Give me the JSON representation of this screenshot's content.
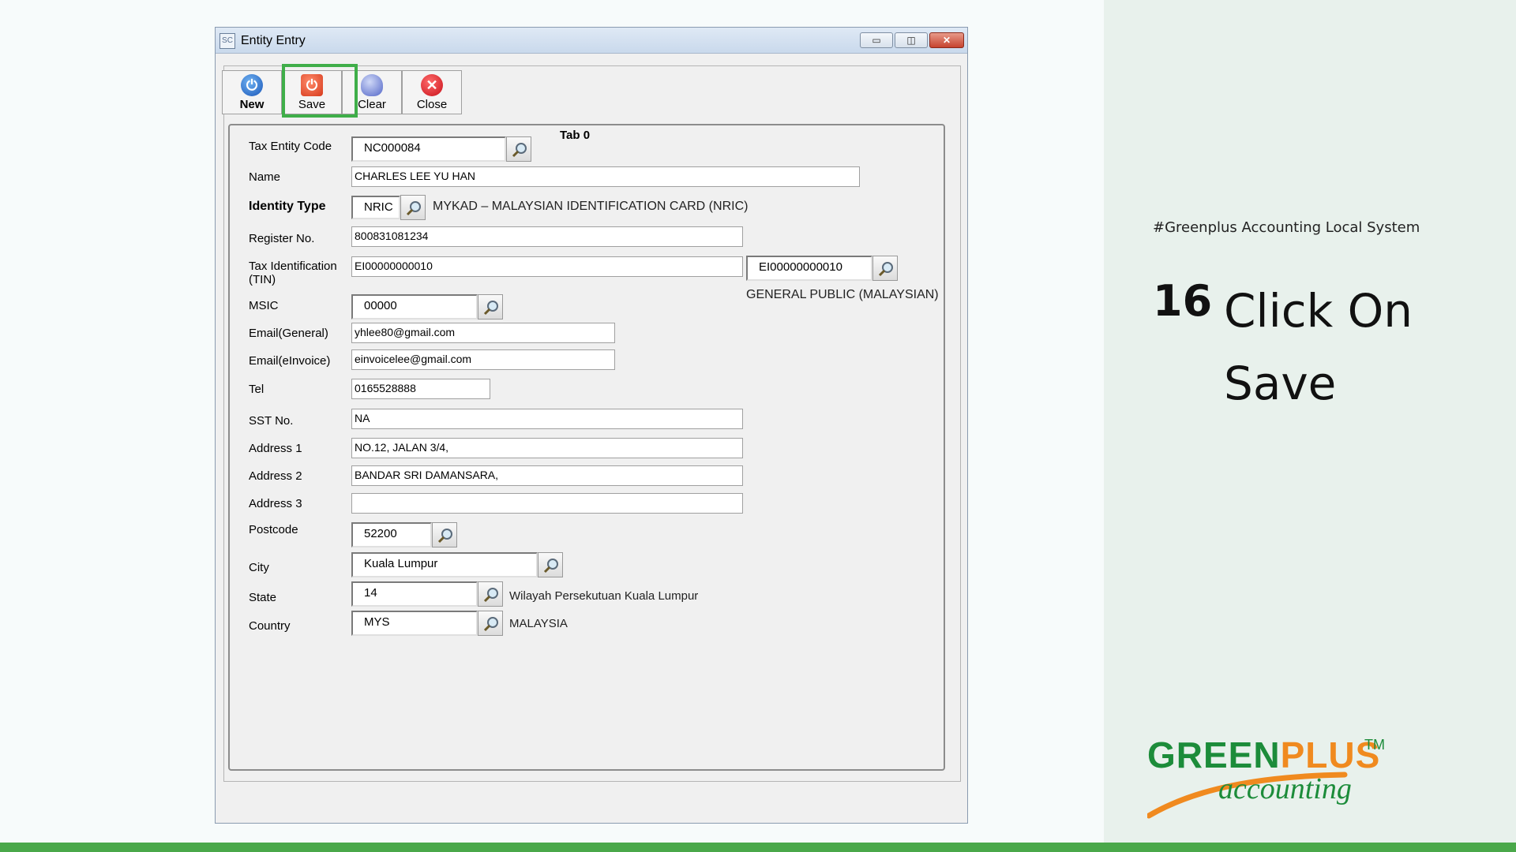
{
  "window": {
    "title": "Entity Entry",
    "app_icon": "SC",
    "controls": {
      "minimize": "▭",
      "maximize": "◫",
      "close": "✕"
    }
  },
  "toolbar": {
    "new_label": "New",
    "save_label": "Save",
    "clear_label": "Clear",
    "close_label": "Close"
  },
  "tab": {
    "label": "Tab 0"
  },
  "form": {
    "tax_entity_code": {
      "label": "Tax Entity Code",
      "value": "NC000084"
    },
    "name": {
      "label": "Name",
      "value": "CHARLES LEE YU HAN"
    },
    "identity_type": {
      "label": "Identity Type",
      "value": "NRIC",
      "description": "MYKAD – MALAYSIAN IDENTIFICATION CARD (NRIC)"
    },
    "register_no": {
      "label": "Register No.",
      "value": "800831081234"
    },
    "tin": {
      "label_line1": "Tax Identification",
      "label_line2": "(TIN)",
      "value": "EI00000000010",
      "lookup_value": "EI00000000010",
      "description": "GENERAL PUBLIC (MALAYSIAN)"
    },
    "msic": {
      "label": "MSIC",
      "value": "00000"
    },
    "email_general": {
      "label": "Email(General)",
      "value": "yhlee80@gmail.com"
    },
    "email_einvoice": {
      "label": "Email(eInvoice)",
      "value": "einvoicelee@gmail.com"
    },
    "tel": {
      "label": "Tel",
      "value": "0165528888"
    },
    "sst_no": {
      "label": "SST No.",
      "value": "NA"
    },
    "address1": {
      "label": "Address 1",
      "value": "NO.12, JALAN 3/4,"
    },
    "address2": {
      "label": "Address 2",
      "value": "BANDAR SRI DAMANSARA,"
    },
    "address3": {
      "label": "Address 3",
      "value": ""
    },
    "postcode": {
      "label": "Postcode",
      "value": "52200"
    },
    "city": {
      "label": "City",
      "value": "Kuala Lumpur"
    },
    "state": {
      "label": "State",
      "value": "14",
      "description": "Wilayah Persekutuan Kuala Lumpur"
    },
    "country": {
      "label": "Country",
      "value": "MYS",
      "description": "MALAYSIA"
    }
  },
  "slide": {
    "hashtag": "#Greenplus Accounting Local System",
    "step_number": "16",
    "step_text": "Click On Save",
    "logo_green": "GREEN",
    "logo_plus": "PLUS",
    "logo_tm": "TM",
    "logo_accounting": "accounting",
    "accent_color": "#3fae49",
    "brand_orange": "#f08a1f"
  }
}
